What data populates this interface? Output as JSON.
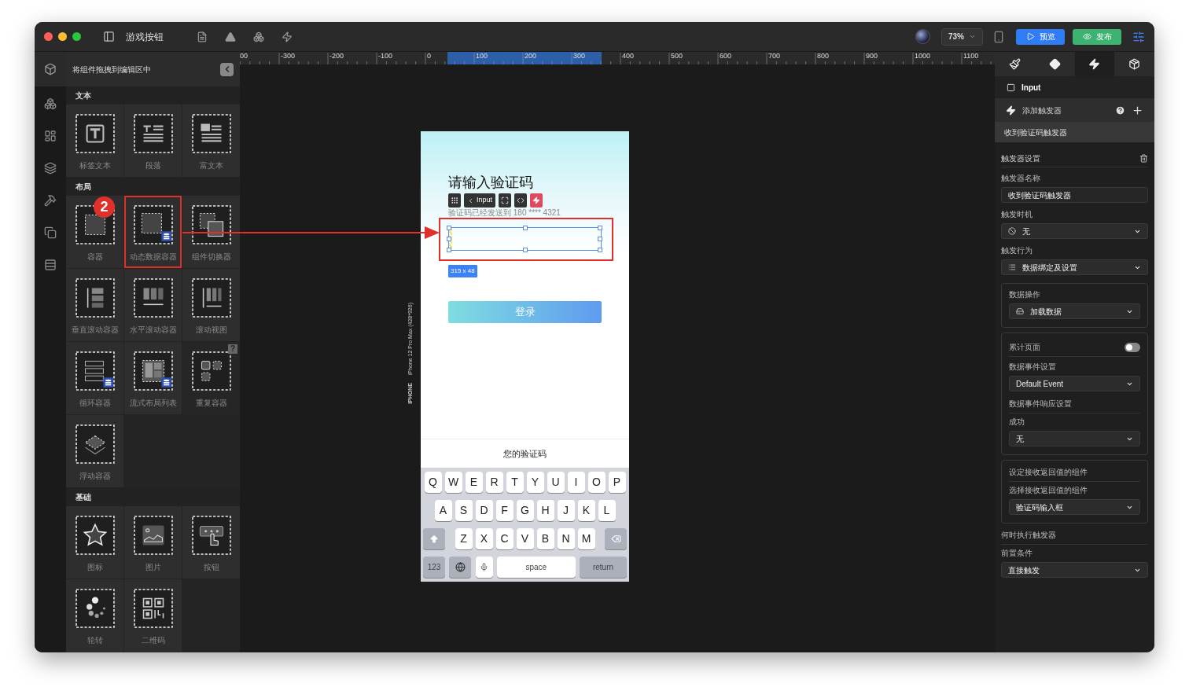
{
  "window": {
    "title": "游戏按钮"
  },
  "toolbar": {
    "zoom": "73%",
    "preview": "预览",
    "publish": "发布"
  },
  "component_panel": {
    "hint": "将组件拖拽到编辑区中",
    "sections": [
      {
        "title": "文本",
        "items": [
          {
            "label": "标签文本",
            "highlighted": false
          },
          {
            "label": "段落",
            "highlighted": false
          },
          {
            "label": "富文本",
            "highlighted": false
          }
        ]
      },
      {
        "title": "布局",
        "items": [
          {
            "label": "容器",
            "highlighted": false
          },
          {
            "label": "动态数据容器",
            "highlighted": true
          },
          {
            "label": "组件切换器",
            "highlighted": false
          },
          {
            "label": "垂直滚动容器",
            "highlighted": false
          },
          {
            "label": "水平滚动容器",
            "highlighted": false
          },
          {
            "label": "滚动视图",
            "highlighted": false
          },
          {
            "label": "循环容器",
            "highlighted": false
          },
          {
            "label": "流式布局列表",
            "highlighted": false
          },
          {
            "label": "重复容器",
            "highlighted": false,
            "badge": "?"
          },
          {
            "label": "浮动容器",
            "highlighted": false
          }
        ]
      },
      {
        "title": "基础",
        "items": [
          {
            "label": "图标",
            "highlighted": false
          },
          {
            "label": "图片",
            "highlighted": false
          },
          {
            "label": "按钮",
            "highlighted": false
          },
          {
            "label": "轮转",
            "highlighted": false
          },
          {
            "label": "二维码",
            "highlighted": false
          }
        ]
      }
    ]
  },
  "canvas": {
    "ruler": [
      "00",
      "-300",
      "-200",
      "-100",
      "0",
      "100",
      "200",
      "300",
      "400",
      "500",
      "600",
      "700",
      "800",
      "900",
      "1000",
      "1100"
    ],
    "annotation_number": "2",
    "device_label": "iPhone 12 Pro Max (428*926)",
    "device_type": "IPHONE",
    "phone": {
      "title": "请输入验证码",
      "subtitle": "验证码已经发送到 180 **** 4321",
      "selected_component": "Input",
      "size": "315 x 48",
      "login_button": "登录",
      "keyboard_title": "您的验证码",
      "keyboard": [
        [
          {
            "kind": "letter",
            "label": "Q"
          },
          {
            "kind": "letter",
            "label": "W"
          },
          {
            "kind": "letter",
            "label": "E"
          },
          {
            "kind": "letter",
            "label": "R"
          },
          {
            "kind": "letter",
            "label": "T"
          },
          {
            "kind": "letter",
            "label": "Y"
          },
          {
            "kind": "letter",
            "label": "U"
          },
          {
            "kind": "letter",
            "label": "I"
          },
          {
            "kind": "letter",
            "label": "O"
          },
          {
            "kind": "letter",
            "label": "P"
          }
        ],
        [
          {
            "kind": "letter",
            "label": "A"
          },
          {
            "kind": "letter",
            "label": "S"
          },
          {
            "kind": "letter",
            "label": "D"
          },
          {
            "kind": "letter",
            "label": "F"
          },
          {
            "kind": "letter",
            "label": "G"
          },
          {
            "kind": "letter",
            "label": "H"
          },
          {
            "kind": "letter",
            "label": "J"
          },
          {
            "kind": "letter",
            "label": "K"
          },
          {
            "kind": "letter",
            "label": "L"
          }
        ],
        [
          {
            "kind": "shift"
          },
          {
            "kind": "letter",
            "label": "Z"
          },
          {
            "kind": "letter",
            "label": "X"
          },
          {
            "kind": "letter",
            "label": "C"
          },
          {
            "kind": "letter",
            "label": "V"
          },
          {
            "kind": "letter",
            "label": "B"
          },
          {
            "kind": "letter",
            "label": "N"
          },
          {
            "kind": "letter",
            "label": "M"
          },
          {
            "kind": "delete"
          }
        ],
        [
          {
            "kind": "function",
            "label": "123"
          },
          {
            "kind": "globe"
          },
          {
            "kind": "mic"
          },
          {
            "kind": "space",
            "label": "space"
          },
          {
            "kind": "return",
            "label": "return"
          }
        ]
      ]
    }
  },
  "inspector": {
    "tabs": [
      {
        "selected": false
      },
      {
        "selected": false
      },
      {
        "selected": true
      },
      {
        "selected": false
      }
    ],
    "element": "Input",
    "trigger_header": "添加触发器",
    "trigger_item": "收到验证码触发器",
    "settings_title": "触发器设置",
    "groups": [
      {
        "boxed": false,
        "rows": [
          {
            "kind": "label",
            "text": "触发器名称"
          },
          {
            "kind": "input",
            "value": "收到验证码触发器"
          },
          {
            "kind": "label",
            "text": "触发时机"
          },
          {
            "kind": "select",
            "value": "无"
          },
          {
            "kind": "label",
            "text": "触发行为"
          },
          {
            "kind": "select",
            "value": "数据绑定及设置"
          }
        ]
      },
      {
        "boxed": true,
        "rows": [
          {
            "kind": "label",
            "text": "数据操作"
          },
          {
            "kind": "select",
            "value": "加载数据"
          }
        ]
      },
      {
        "boxed": true,
        "rows": [
          {
            "kind": "toggle",
            "text": "累计页面",
            "on": false
          },
          {
            "kind": "label",
            "text": "数据事件设置"
          },
          {
            "kind": "select",
            "value": "Default Event"
          },
          {
            "kind": "heading",
            "text": "数据事件响应设置"
          },
          {
            "kind": "label",
            "text": "成功"
          },
          {
            "kind": "select",
            "value": "无"
          }
        ]
      },
      {
        "boxed": true,
        "rows": [
          {
            "kind": "heading",
            "text": "设定接收返回值的组件"
          },
          {
            "kind": "label",
            "text": "选择接收返回值的组件"
          },
          {
            "kind": "select",
            "value": "验证码输入框"
          }
        ]
      },
      {
        "boxed": false,
        "rows": [
          {
            "kind": "heading",
            "text": "何时执行触发器"
          },
          {
            "kind": "label",
            "text": "前置条件"
          },
          {
            "kind": "select",
            "value": "直接触发"
          }
        ]
      }
    ]
  }
}
